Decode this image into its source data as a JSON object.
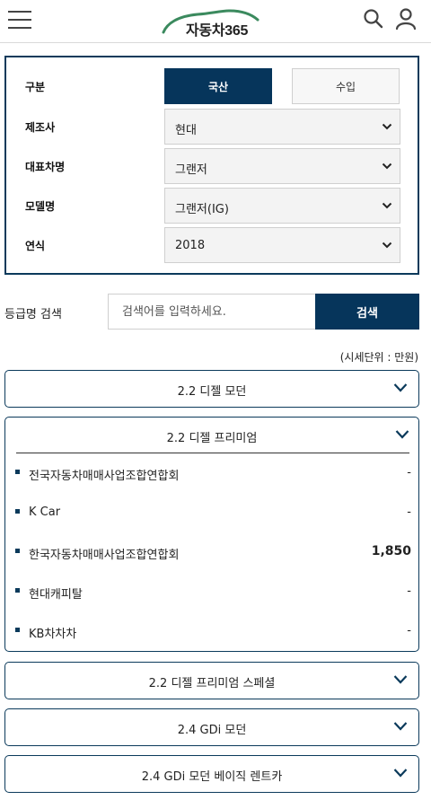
{
  "header": {
    "logo_text": "자동차365",
    "menu_icon": "hamburger-menu-icon",
    "search_icon": "search-icon",
    "user_icon": "user-icon",
    "logo_colors": [
      "#3b8a5e",
      "#0b3a5b"
    ]
  },
  "filter": {
    "type_label": "구분",
    "domestic_label": "국산",
    "import_label": "수입",
    "maker_label": "제조사",
    "maker_value": "현대",
    "model_label": "대표차명",
    "model_value": "그랜저",
    "submodel_label": "모델명",
    "submodel_value": "그랜저(IG)",
    "year_label": "연식",
    "year_value": "2018"
  },
  "search": {
    "label": "등급명 검색",
    "placeholder": "검색어를 입력하세요.",
    "button_label": "검색"
  },
  "unit_note": "(시세단위 : 만원)",
  "grades": [
    {
      "title": "2.2 디젤 모던",
      "expanded": false
    },
    {
      "title": "2.2 디젤 프리미엄",
      "expanded": true,
      "prices": [
        {
          "source": "전국자동차매매사업조합연합회",
          "value": "-"
        },
        {
          "source": "K Car",
          "value": "-"
        },
        {
          "source": "한국자동차매매사업조합연합회",
          "value": "1,850"
        },
        {
          "source": "현대캐피탈",
          "value": "-"
        },
        {
          "source": "KB차차차",
          "value": "-"
        }
      ]
    },
    {
      "title": "2.2 디젤 프리미엄 스페셜",
      "expanded": false
    },
    {
      "title": "2.4 GDi 모던",
      "expanded": false
    },
    {
      "title": "2.4 GDi 모던 베이직 렌트카",
      "expanded": false
    }
  ],
  "colors": {
    "primary": "#06355b",
    "border": "#0b3a5b"
  }
}
